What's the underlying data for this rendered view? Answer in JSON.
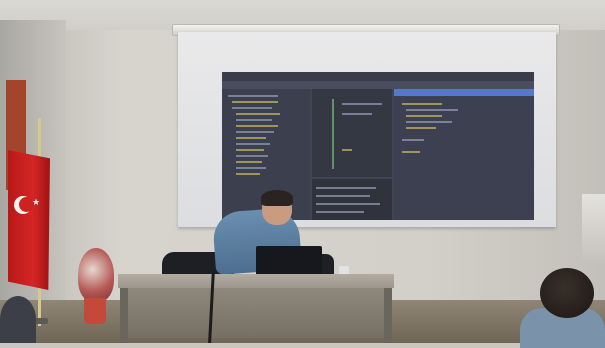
{
  "scene": {
    "description_free": true,
    "colors": {
      "wall": "#d2d0c8",
      "screen": "#e3e4e6",
      "ide_background": "#33384a",
      "flag_red": "#d42626",
      "shirt_blue": "#5b7fa2"
    },
    "icons": [
      "crescent-star-icon"
    ]
  }
}
